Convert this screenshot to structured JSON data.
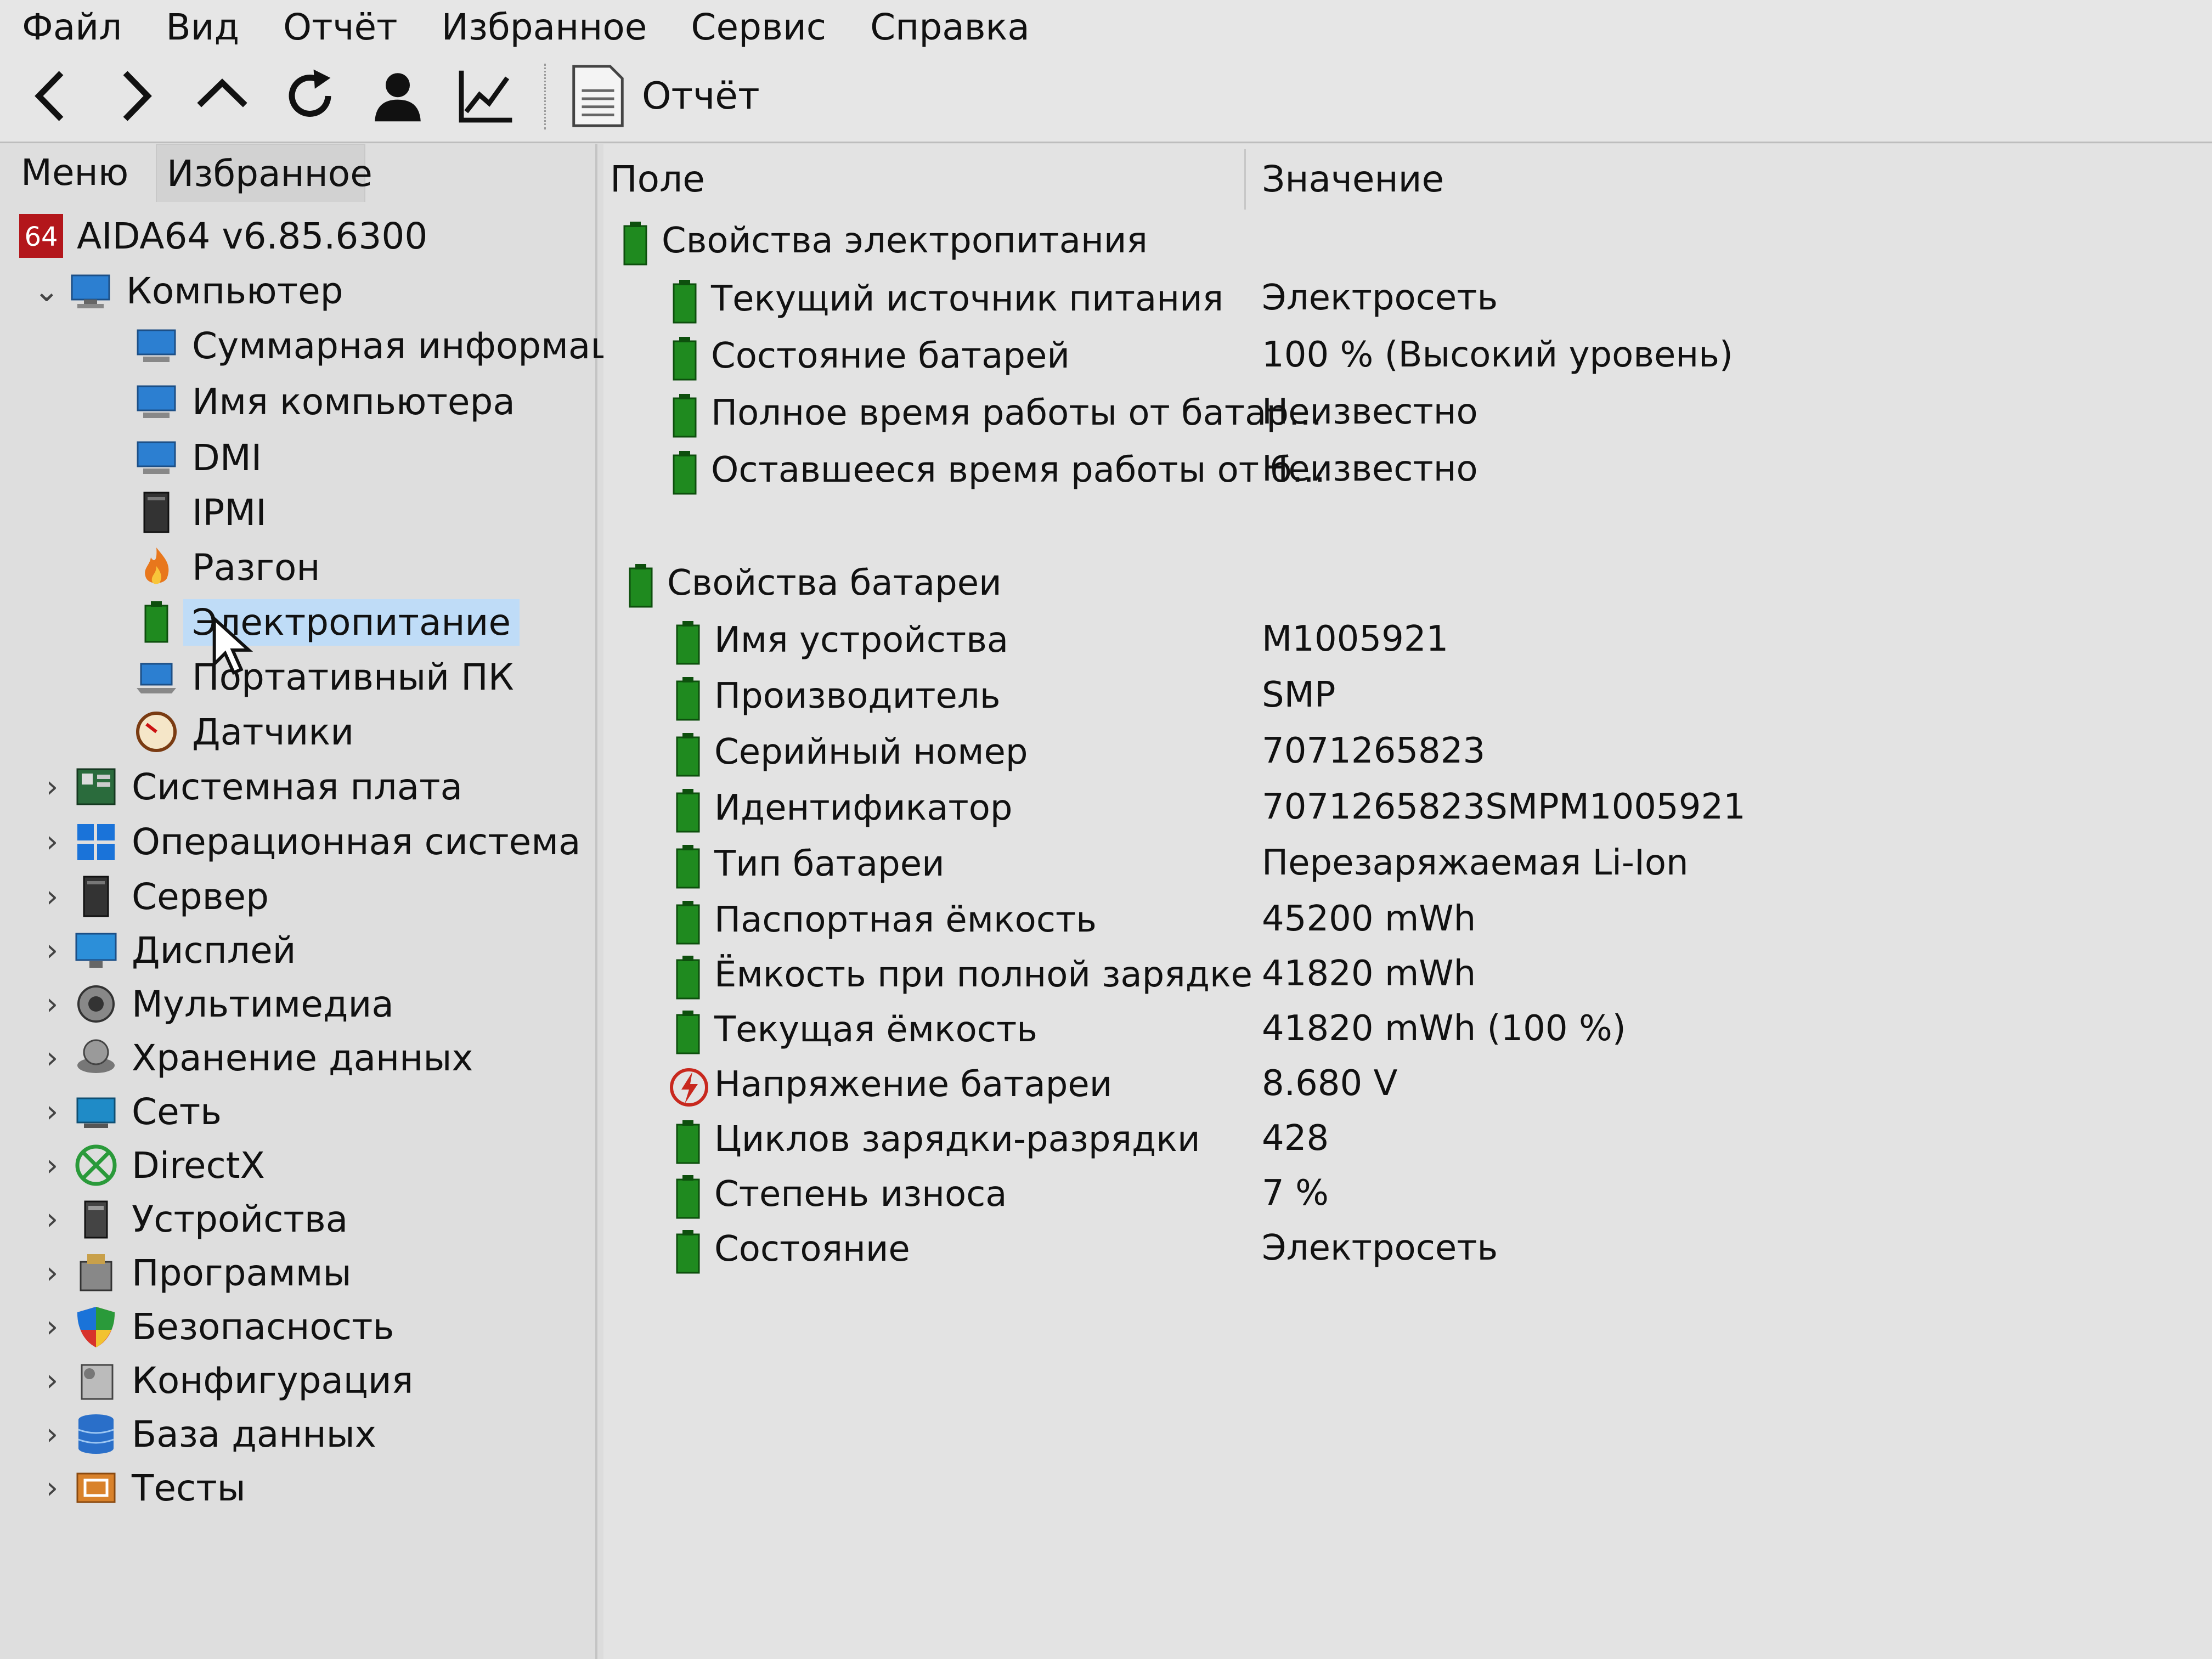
{
  "menu": [
    "Файл",
    "Вид",
    "Отчёт",
    "Избранное",
    "Сервис",
    "Справка"
  ],
  "toolbar": {
    "buttons": [
      "back-icon",
      "forward-icon",
      "up-icon",
      "refresh-icon",
      "user-icon",
      "chart-icon"
    ],
    "report_label": "Отчёт"
  },
  "left_tabs": [
    "Меню",
    "Избранное"
  ],
  "tree": {
    "root": "AIDA64 v6.85.6300",
    "root_badge": "64",
    "computer": "Компьютер",
    "computer_children": [
      "Суммарная информаци",
      "Имя компьютера",
      "DMI",
      "IPMI",
      "Разгон",
      "Электропитание",
      "Портативный ПК",
      "Датчики"
    ],
    "selected": "Электропитание",
    "categories": [
      "Системная плата",
      "Операционная система",
      "Сервер",
      "Дисплей",
      "Мультимедиа",
      "Хранение данных",
      "Сеть",
      "DirectX",
      "Устройства",
      "Программы",
      "Безопасность",
      "Конфигурация",
      "База данных",
      "Тесты"
    ]
  },
  "columns": {
    "field": "Поле",
    "value": "Значение"
  },
  "power": {
    "header": "Свойства электропитания",
    "rows": [
      {
        "field": "Текущий источник питания",
        "value": "Электросеть"
      },
      {
        "field": "Состояние батарей",
        "value": "100 % (Высокий уровень)"
      },
      {
        "field": "Полное время работы от батар...",
        "value": "Неизвестно"
      },
      {
        "field": "Оставшееся время работы от б...",
        "value": "Неизвестно"
      }
    ]
  },
  "battery": {
    "header": "Свойства батареи",
    "rows": [
      {
        "field": "Имя устройства",
        "value": "M1005921"
      },
      {
        "field": "Производитель",
        "value": "SMP"
      },
      {
        "field": "Серийный номер",
        "value": "7071265823"
      },
      {
        "field": "Идентификатор",
        "value": "7071265823SMPM1005921"
      },
      {
        "field": "Тип батареи",
        "value": "Перезаряжаемая Li-Ion"
      },
      {
        "field": "Паспортная ёмкость",
        "value": "45200 mWh"
      },
      {
        "field": "Ёмкость при полной зарядке",
        "value": "41820 mWh"
      },
      {
        "field": "Текущая ёмкость",
        "value": "41820 mWh  (100 %)"
      },
      {
        "field": "Напряжение батареи",
        "value": "8.680 V"
      },
      {
        "field": "Циклов зарядки-разрядки",
        "value": "428"
      },
      {
        "field": "Степень износа",
        "value": "7 %"
      },
      {
        "field": "Состояние",
        "value": "Электросеть"
      }
    ]
  }
}
